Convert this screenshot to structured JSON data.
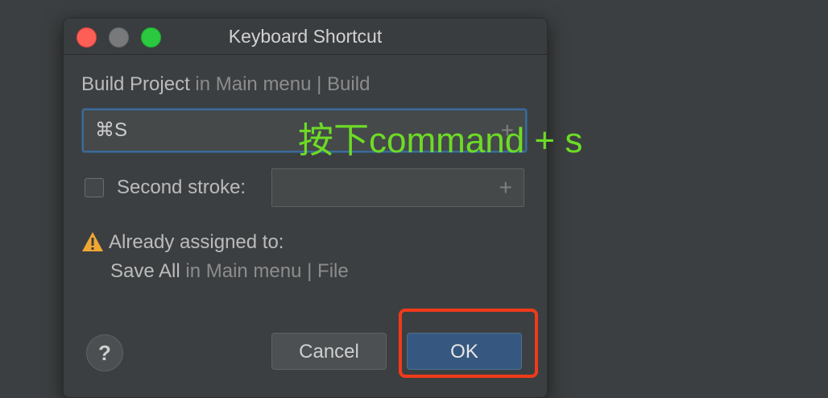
{
  "dialog": {
    "title": "Keyboard Shortcut",
    "action": {
      "name": "Build Project",
      "location": "in Main menu | Build"
    },
    "shortcut": {
      "value": "⌘S",
      "add_symbol": "+"
    },
    "second_stroke": {
      "label": "Second stroke:",
      "checked": false,
      "value": "",
      "add_symbol": "+"
    },
    "warning": {
      "icon": "warning-triangle-icon",
      "text": "Already assigned to:",
      "action": "Save All",
      "location": "in Main menu | File"
    },
    "buttons": {
      "help": "?",
      "cancel": "Cancel",
      "ok": "OK"
    }
  },
  "annotation": {
    "text": "按下command + s",
    "color": "#6ddc25"
  },
  "highlight_color": "#f13a1a"
}
